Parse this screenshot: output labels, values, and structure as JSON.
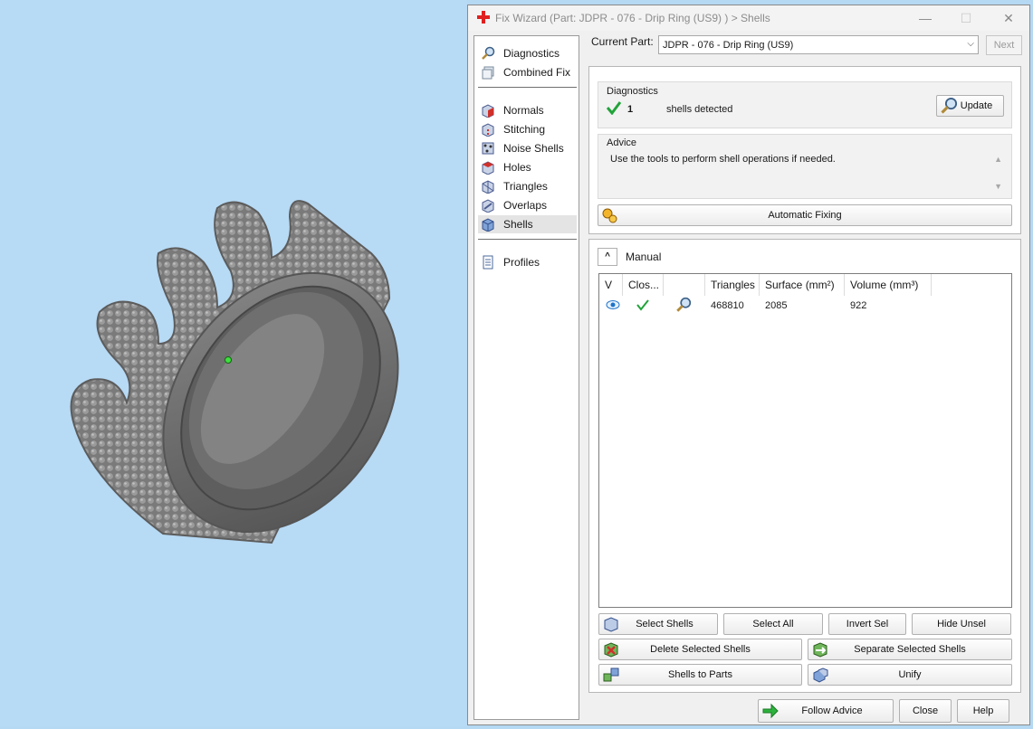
{
  "window": {
    "title": "Fix Wizard (Part: JDPR - 076 - Drip Ring (US9)  ) > Shells",
    "minimize": "—",
    "maximize": "☐",
    "close": "✕"
  },
  "nav": {
    "items": [
      {
        "label": "Diagnostics",
        "icon": "magnifier-icon"
      },
      {
        "label": "Combined Fix",
        "icon": "cube-stack-icon"
      },
      {
        "label": "Normals",
        "icon": "normals-cube-icon"
      },
      {
        "label": "Stitching",
        "icon": "stitching-cube-icon"
      },
      {
        "label": "Noise Shells",
        "icon": "noise-shells-icon"
      },
      {
        "label": "Holes",
        "icon": "holes-cube-icon"
      },
      {
        "label": "Triangles",
        "icon": "triangles-cube-icon"
      },
      {
        "label": "Overlaps",
        "icon": "overlaps-cube-icon"
      },
      {
        "label": "Shells",
        "icon": "shells-cube-icon",
        "active": true
      },
      {
        "label": "Profiles",
        "icon": "document-icon"
      }
    ]
  },
  "current_part": {
    "label": "Current Part:",
    "value": "JDPR - 076 - Drip Ring (US9)",
    "next_label": "Next"
  },
  "diagnostics": {
    "title": "Diagnostics",
    "count": "1",
    "text": "shells detected",
    "update_label": "Update"
  },
  "advice": {
    "title": "Advice",
    "text": "Use the tools to perform shell operations if needed."
  },
  "automatic_fixing_label": "Automatic Fixing",
  "manual": {
    "title": "Manual",
    "columns": [
      "V",
      "Clos...",
      "",
      "Triangles",
      "Surface (mm²)",
      "Volume (mm³)"
    ],
    "rows": [
      {
        "visible_icon": "eye-icon",
        "closed_icon": "check-icon",
        "tool_icon": "magnifier-icon",
        "triangles": "468810",
        "surface": "2085",
        "volume": "922"
      }
    ]
  },
  "buttons": {
    "select_shells": "Select Shells",
    "select_all": "Select All",
    "invert_sel": "Invert Sel",
    "hide_unsel": "Hide Unsel",
    "delete_selected": "Delete Selected Shells",
    "separate_selected": "Separate Selected Shells",
    "shells_to_parts": "Shells to Parts",
    "unify": "Unify",
    "follow_advice": "Follow Advice",
    "close": "Close",
    "help": "Help"
  },
  "colors": {
    "viewport_bg": "#b7daf5",
    "ring": "#6b6b6b",
    "check": "#22a33a",
    "title_cross": "#e02020"
  }
}
